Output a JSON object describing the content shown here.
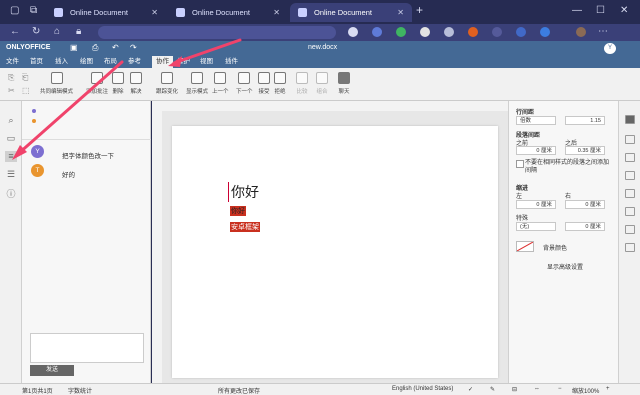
{
  "browser": {
    "tabs": [
      {
        "label": "Online Document",
        "active": false
      },
      {
        "label": "Online Document",
        "active": false
      },
      {
        "label": "Online Document",
        "active": true
      }
    ],
    "new_tab": "+",
    "window_controls": {
      "minimize": "—",
      "maximize": "☐",
      "close": "✕"
    }
  },
  "app": {
    "logo": "ONLYOFFICE",
    "doc_title": "new.docx"
  },
  "menu": {
    "items": [
      "文件",
      "首页",
      "插入",
      "绘图",
      "布局",
      "参考",
      "协作",
      "保护",
      "视图",
      "插件"
    ],
    "active_index": 6
  },
  "toolbar": {
    "buttons": [
      "共同编辑模式",
      "添加批注",
      "删除",
      "解决",
      "跟踪变化",
      "显示模式",
      "上一个",
      "下一个",
      "接受",
      "拒绝",
      "比较",
      "组合",
      "聊天"
    ],
    "dim_indexes": [
      10,
      11
    ]
  },
  "comments": [
    {
      "avatar": "Y",
      "color": "#7d6fd1",
      "text": "把字体颜色改一下"
    },
    {
      "avatar": "T",
      "color": "#e9952f",
      "text": "好的"
    }
  ],
  "comment_send": "发送",
  "document": {
    "heading": "你好",
    "line2": "你好",
    "line3": "安卓框架"
  },
  "right_panel": {
    "line_spacing_label": "行间距",
    "line_spacing_mode": "倍数",
    "line_spacing_value": "1.15",
    "para_spacing_label": "段落间距",
    "before_label": "之前",
    "after_label": "之后",
    "before_value": "0 厘米",
    "after_value": "0.35 厘米",
    "no_space_label": "不要在相同样式的段落之间添加间隔",
    "indent_label": "缩进",
    "left_label": "左",
    "right_label": "右",
    "left_value": "0 厘米",
    "right_value": "0 厘米",
    "special_label": "特殊",
    "special_value": "(无)",
    "special_amount": "0 厘米",
    "bg_color_label": "背景颜色",
    "advanced_link": "显示高级设置"
  },
  "status": {
    "page": "第1页共1页",
    "word_count": "字数统计",
    "saved": "所有更改已保存",
    "language": "English (United States)",
    "zoom": "缩放100%"
  }
}
